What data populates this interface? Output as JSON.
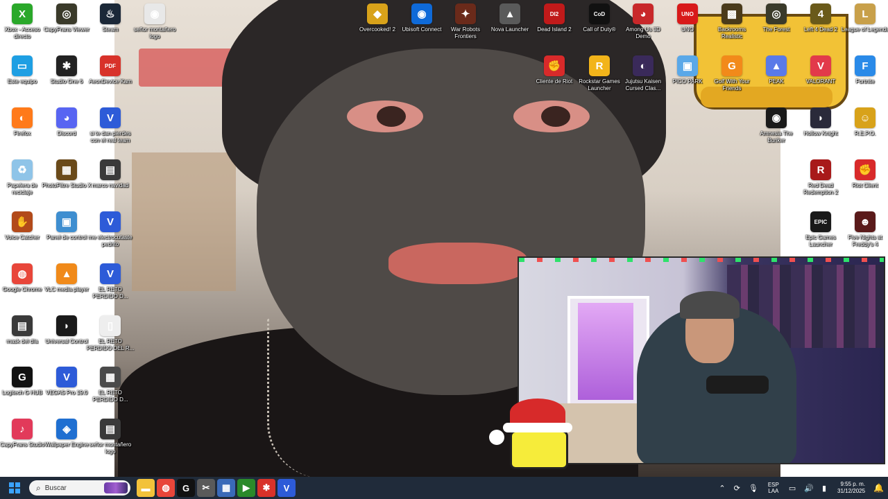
{
  "desktop": {
    "icons": [
      {
        "label": "Xbox - Acceso directo",
        "glyph": "X",
        "color": "#2aa82a"
      },
      {
        "label": "CapyFrans Viewer",
        "glyph": "◎",
        "color": "#3a3a2a"
      },
      {
        "label": "Steam",
        "glyph": "♨",
        "color": "#1b2838"
      },
      {
        "label": "señor montañero logo",
        "glyph": "◉",
        "color": "#e8e8e8"
      },
      {
        "label": "Este equipo",
        "glyph": "▭",
        "color": "#1e9fe3"
      },
      {
        "label": "Studio One 6",
        "glyph": "✱",
        "color": "#222222"
      },
      {
        "label": "AeonDevice Kam",
        "glyph": "PDF",
        "color": "#d8322a"
      },
      {
        "label": "Firefox",
        "glyph": "◐",
        "color": "#ff7a1a"
      },
      {
        "label": "Discord",
        "glyph": "◕",
        "color": "#5865f2"
      },
      {
        "label": "si te dan pierdes con el real team",
        "glyph": "V",
        "color": "#2d5bd8"
      },
      {
        "label": "Papelera de reciclaje",
        "glyph": "♻",
        "color": "#8fc4e8"
      },
      {
        "label": "PhotoFiltre Studio X",
        "glyph": "▦",
        "color": "#6a4a1a"
      },
      {
        "label": "marco navidad",
        "glyph": "▤",
        "color": "#3a3a3a"
      },
      {
        "label": "Voice Catcher",
        "glyph": "✋",
        "color": "#b24a1a"
      },
      {
        "label": "Panel de control",
        "glyph": "▣",
        "color": "#3e8ed0"
      },
      {
        "label": "me electrocutaste pedrito",
        "glyph": "V",
        "color": "#2d5bd8"
      },
      {
        "label": "Google Chrome",
        "glyph": "◍",
        "color": "#e8463a"
      },
      {
        "label": "VLC media player",
        "glyph": "▲",
        "color": "#f08a1a"
      },
      {
        "label": "EL RETO PERDIDO D...",
        "glyph": "V",
        "color": "#2d5bd8"
      },
      {
        "label": "mask del día",
        "glyph": "▤",
        "color": "#3a3a3a"
      },
      {
        "label": "Universal Control",
        "glyph": "◗",
        "color": "#1a1a1a"
      },
      {
        "label": "EL RETO PERDIDO DEL R...",
        "glyph": "▯",
        "color": "#eeeeee"
      },
      {
        "label": "Logitech G HUB",
        "glyph": "G",
        "color": "#111111"
      },
      {
        "label": "VEGAS Pro 19.0",
        "glyph": "V",
        "color": "#2d5bd8"
      },
      {
        "label": "EL RETO PERDIDO D...",
        "glyph": "▦",
        "color": "#4a4a4a"
      },
      {
        "label": "CapyFrans Studio",
        "glyph": "♪",
        "color": "#e23a5a"
      },
      {
        "label": "Wallpaper Engine",
        "glyph": "◈",
        "color": "#1f6fd1"
      },
      {
        "label": "señor montañero logo",
        "glyph": "▤",
        "color": "#3a3a3a"
      },
      {
        "label": "Overcooked! 2",
        "glyph": "◆",
        "color": "#d8a21a"
      },
      {
        "label": "Ubisoft Connect",
        "glyph": "◉",
        "color": "#0f6ad8"
      },
      {
        "label": "War Robots Frontiers",
        "glyph": "✦",
        "color": "#6a2a1a"
      },
      {
        "label": "Nova Launcher",
        "glyph": "▲",
        "color": "#5a5a5a"
      },
      {
        "label": "Dead Island 2",
        "glyph": "DI2",
        "color": "#c01a1a"
      },
      {
        "label": "Call of Duty®",
        "glyph": "CoD",
        "color": "#111111"
      },
      {
        "label": "Among Us 3D Demo",
        "glyph": "◕",
        "color": "#c8282a"
      },
      {
        "label": "UNO",
        "glyph": "UNO",
        "color": "#d81a1a"
      },
      {
        "label": "Backrooms Realistic",
        "glyph": "▩",
        "color": "#4a3a1a"
      },
      {
        "label": "The Forest",
        "glyph": "◎",
        "color": "#3a3a2a"
      },
      {
        "label": "Left 4 Dead 2",
        "glyph": "4",
        "color": "#6a5a1a"
      },
      {
        "label": "League of Legends",
        "glyph": "L",
        "color": "#c8a04a"
      },
      {
        "label": "Cliente de Riot",
        "glyph": "✊",
        "color": "#d82a2a"
      },
      {
        "label": "Rockstar Games Launcher",
        "glyph": "R",
        "color": "#f2b41a"
      },
      {
        "label": "Jujutsu Kaisen Cursed Clas...",
        "glyph": "◐",
        "color": "#3a2a5a"
      },
      {
        "label": "PICO PARK",
        "glyph": "▣",
        "color": "#5aa8e8"
      },
      {
        "label": "Golf With Your Friends",
        "glyph": "G",
        "color": "#f28a1a"
      },
      {
        "label": "PEAK",
        "glyph": "▲",
        "color": "#5a7ae8"
      },
      {
        "label": "VALORANT",
        "glyph": "V",
        "color": "#e23a4a"
      },
      {
        "label": "Fortnite",
        "glyph": "F",
        "color": "#2a8ae8"
      },
      {
        "label": "Amnesia The Bunker",
        "glyph": "◉",
        "color": "#1a1a1a"
      },
      {
        "label": "Hollow Knight",
        "glyph": "◗",
        "color": "#2a2a3a"
      },
      {
        "label": "R.E.P.O.",
        "glyph": "☺",
        "color": "#d8a21a"
      },
      {
        "label": "Red Dead Redemption 2",
        "glyph": "R",
        "color": "#a81a1a"
      },
      {
        "label": "Riot Client",
        "glyph": "✊",
        "color": "#d82a2a"
      },
      {
        "label": "Epic Games Launcher",
        "glyph": "EPIC",
        "color": "#1a1a1a"
      },
      {
        "label": "Five Nights at Freddy's 4",
        "glyph": "☻",
        "color": "#5a1a1a"
      }
    ]
  },
  "taskbar": {
    "search_placeholder": "Buscar",
    "apps": [
      {
        "name": "file-explorer",
        "glyph": "▬",
        "color": "#f2c23a"
      },
      {
        "name": "chrome",
        "glyph": "◍",
        "color": "#e8463a"
      },
      {
        "name": "logitech-ghub",
        "glyph": "G",
        "color": "#111111"
      },
      {
        "name": "snipping-tool",
        "glyph": "✂",
        "color": "#5a5a5a"
      },
      {
        "name": "calculator",
        "glyph": "▦",
        "color": "#3a6ab8"
      },
      {
        "name": "voice-app",
        "glyph": "▶",
        "color": "#2a8a2a"
      },
      {
        "name": "adobe-app",
        "glyph": "✱",
        "color": "#d8322a"
      },
      {
        "name": "vegas-pro",
        "glyph": "V",
        "color": "#2d5bd8"
      }
    ],
    "tray": {
      "language": "ESP",
      "region": "LAA",
      "time": "9:55 p. m.",
      "date": "31/12/2025"
    }
  }
}
